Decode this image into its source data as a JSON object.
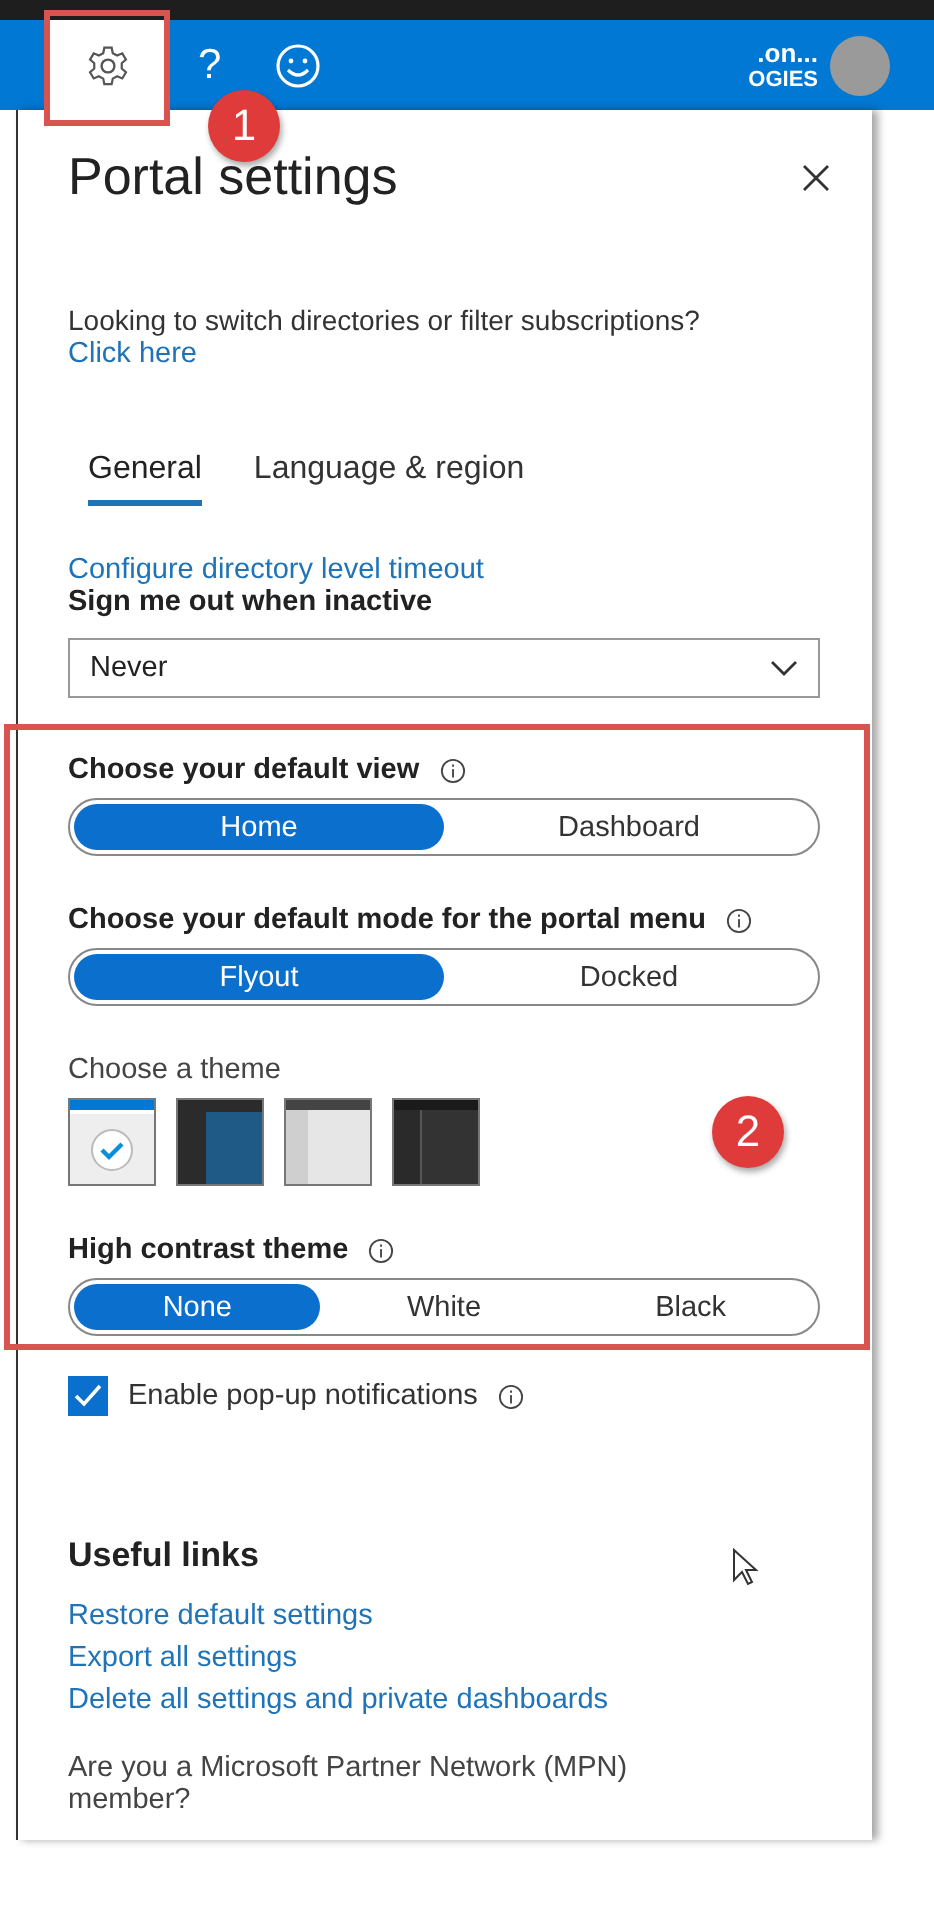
{
  "top_bar": {
    "buttons": [
      {
        "kind": "settings",
        "selected": true
      },
      {
        "kind": "help",
        "glyph": "?",
        "selected": false
      },
      {
        "kind": "feedback",
        "selected": false
      }
    ],
    "account_name": ".on...",
    "account_org": "OGIES"
  },
  "annotations": [
    {
      "label": "1"
    },
    {
      "label": "2"
    }
  ],
  "panel": {
    "title": "Portal settings",
    "intro": "Looking to switch directories or filter subscriptions?",
    "intro_link": "Click here",
    "tabs": [
      {
        "label": "General",
        "selected": true
      },
      {
        "label": "Language & region",
        "selected": false
      }
    ],
    "timeout_link": "Configure directory level timeout",
    "signout": {
      "label": "Sign me out when inactive",
      "value": "Never"
    },
    "toggles": [
      {
        "label": "Choose your default view",
        "options": [
          {
            "label": "Home",
            "selected": true
          },
          {
            "label": "Dashboard",
            "selected": false
          }
        ]
      },
      {
        "label": "Choose your default mode for the portal menu",
        "options": [
          {
            "label": "Flyout",
            "selected": true
          },
          {
            "label": "Docked",
            "selected": false
          }
        ]
      }
    ],
    "theme": {
      "label": "Choose a theme",
      "swatches": [
        {
          "kind": "azure",
          "selected": true
        },
        {
          "kind": "blue-dark",
          "selected": false
        },
        {
          "kind": "light-grey",
          "selected": false
        },
        {
          "kind": "dark",
          "selected": false
        }
      ]
    },
    "high_contrast": {
      "label": "High contrast theme",
      "options": [
        {
          "label": "None",
          "selected": true
        },
        {
          "label": "White",
          "selected": false
        },
        {
          "label": "Black",
          "selected": false
        }
      ]
    },
    "notifications": {
      "label": "Enable pop-up notifications",
      "checked": true
    },
    "useful_links": {
      "title": "Useful links",
      "links": [
        "Restore default settings",
        "Export all settings",
        "Delete all settings and private dashboards"
      ]
    },
    "mpn_question": "Are you a Microsoft Partner Network (MPN) member?"
  }
}
